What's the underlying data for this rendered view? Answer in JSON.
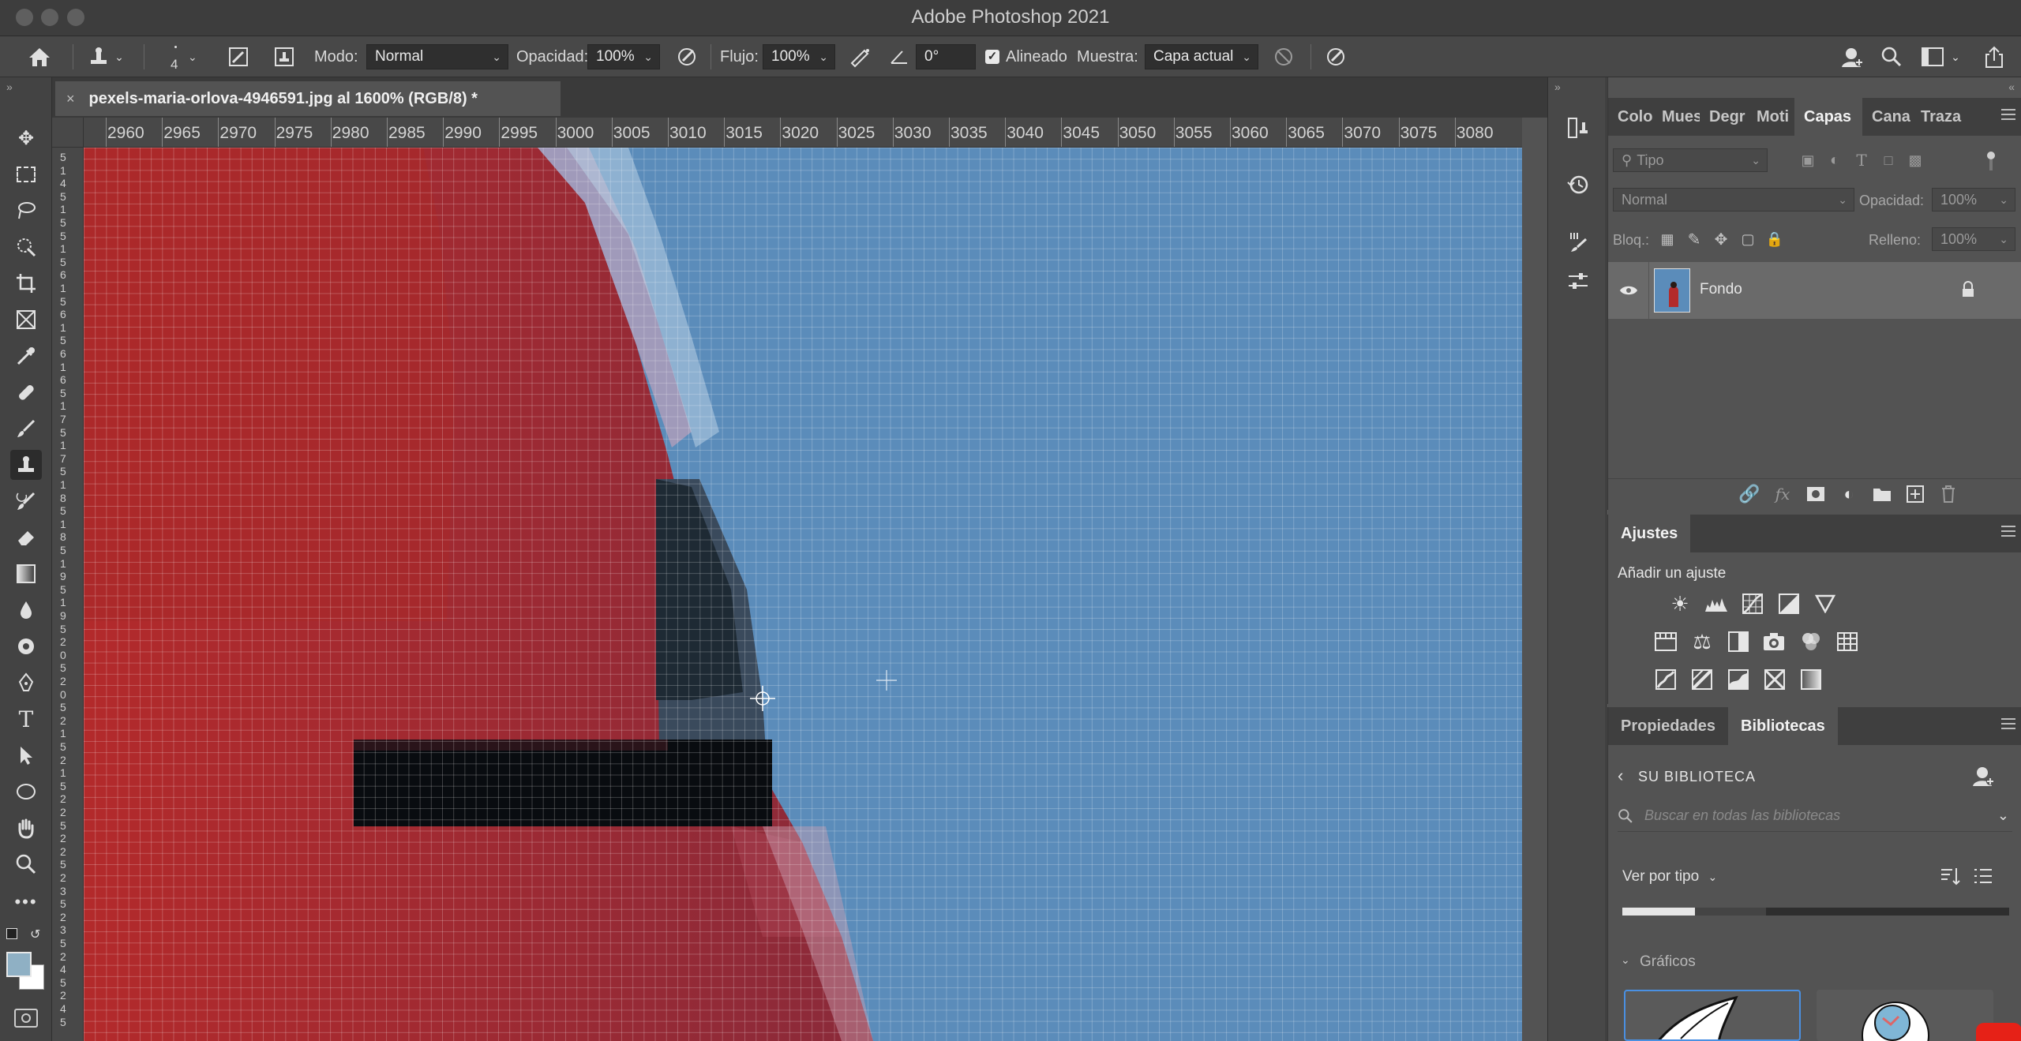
{
  "window": {
    "title": "Adobe Photoshop 2021"
  },
  "options_bar": {
    "brush_size": "4",
    "mode_label": "Modo:",
    "mode_value": "Normal",
    "opacity_label": "Opacidad:",
    "opacity_value": "100%",
    "flow_label": "Flujo:",
    "flow_value": "100%",
    "angle_value": "0°",
    "aligned_label": "Alineado",
    "sample_label": "Muestra:",
    "sample_value": "Capa actual"
  },
  "document": {
    "tab_title": "pexels-maria-orlova-4946591.jpg al 1600% (RGB/8) *",
    "close_glyph": "×"
  },
  "ruler_h": [
    "2960",
    "2965",
    "2970",
    "2975",
    "2980",
    "2985",
    "2990",
    "2995",
    "3000",
    "3005",
    "3010",
    "3015",
    "3020",
    "3025",
    "3030",
    "3035",
    "3040",
    "3045",
    "3050",
    "3055",
    "3060",
    "3065",
    "3070",
    "3075",
    "3080"
  ],
  "ruler_v": [
    "5",
    "1",
    "4",
    "5",
    "1",
    "5",
    "5",
    "1",
    "5",
    "6",
    "1",
    "5",
    "6",
    "1",
    "5",
    "6",
    "1",
    "6",
    "5",
    "1",
    "7",
    "5",
    "1",
    "7",
    "5",
    "1",
    "8",
    "5",
    "1",
    "8",
    "5",
    "1",
    "9",
    "5",
    "1",
    "9",
    "5",
    "2",
    "0",
    "5",
    "2",
    "0",
    "5",
    "2",
    "1",
    "5",
    "2",
    "1",
    "5",
    "2",
    "2",
    "5",
    "2",
    "2",
    "5",
    "2",
    "3",
    "5",
    "2",
    "3",
    "5",
    "2",
    "4",
    "5",
    "2",
    "4",
    "5"
  ],
  "layers_panel": {
    "tabs": [
      "Colo",
      "Mues",
      "Degr",
      "Moti",
      "Capas",
      "Cana",
      "Traza"
    ],
    "active_tab": "Capas",
    "search_placeholder": "Tipo",
    "blend_mode": "Normal",
    "opacity_label": "Opacidad:",
    "opacity_value": "100%",
    "lock_label": "Bloq.:",
    "fill_label": "Relleno:",
    "fill_value": "100%",
    "layers": [
      {
        "name": "Fondo",
        "visible": true,
        "locked": true
      }
    ]
  },
  "adjustments_panel": {
    "tab": "Ajustes",
    "subtitle": "Añadir un ajuste"
  },
  "libraries_panel": {
    "tabs": [
      "Propiedades",
      "Bibliotecas"
    ],
    "active_tab": "Bibliotecas",
    "back_label": "SU BIBLIOTECA",
    "search_placeholder": "Buscar en todas las bibliotecas",
    "view_label": "Ver por tipo",
    "section_label": "Gráficos"
  },
  "colors": {
    "accent": "#4a90e2",
    "foreground_swatch": "#8fb0c4",
    "background_swatch": "#ffffff"
  }
}
